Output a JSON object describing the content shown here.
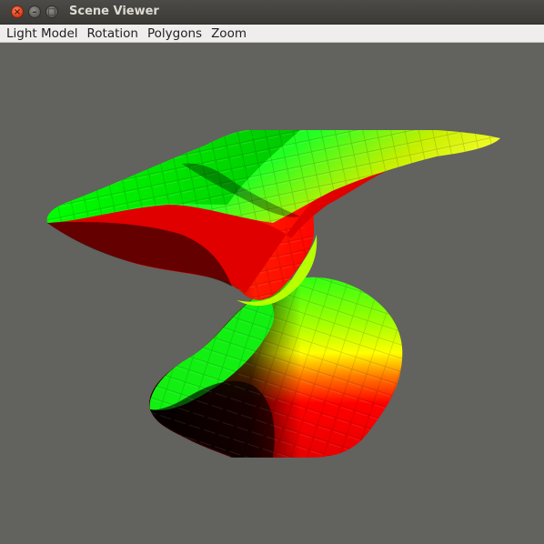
{
  "window": {
    "title": "Scene Viewer",
    "controls": {
      "close": "×",
      "minimize": "–",
      "maximize": "□"
    }
  },
  "menubar": {
    "items": [
      "Light Model",
      "Rotation",
      "Polygons",
      "Zoom"
    ]
  },
  "scene": {
    "background_color": "#62625e",
    "surface_colors": [
      "#00ff00",
      "#ffff00",
      "#ff0000",
      "#000000"
    ],
    "object": "shaded 3D surface"
  }
}
